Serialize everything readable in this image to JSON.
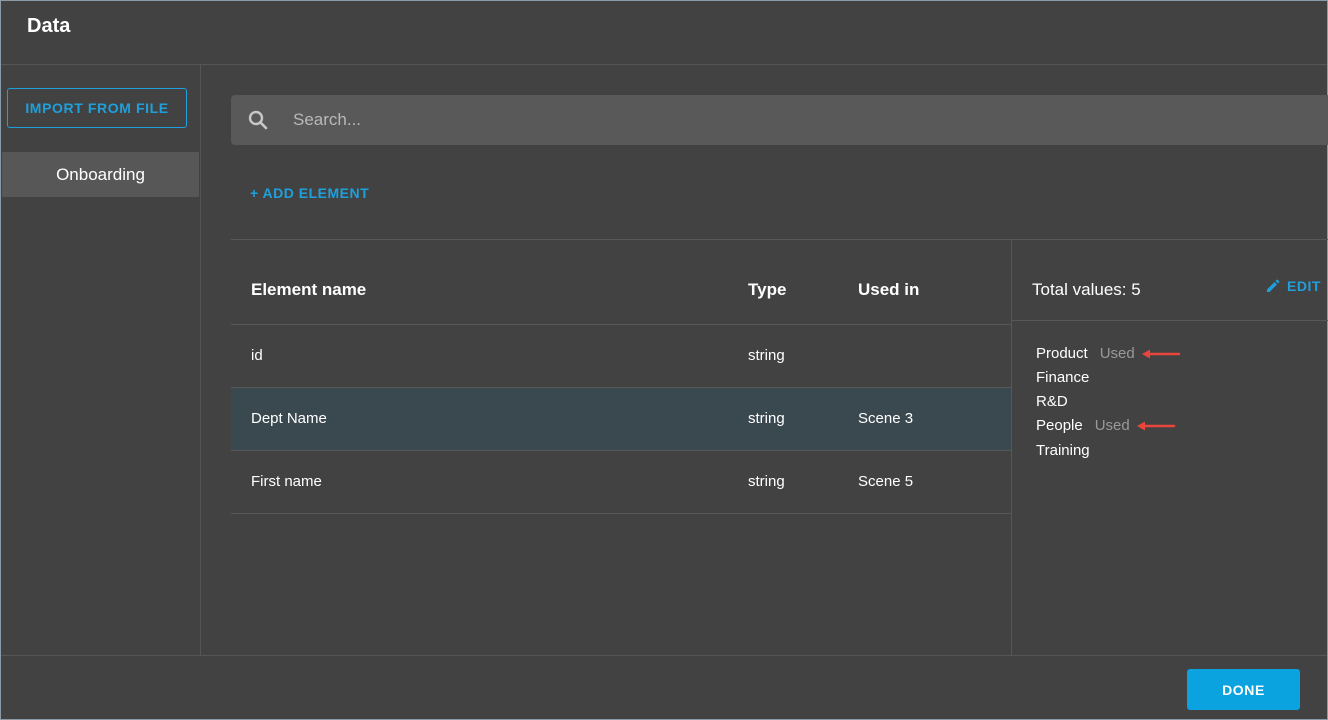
{
  "dialog": {
    "title": "Data"
  },
  "sidebar": {
    "import_label": "IMPORT FROM FILE",
    "items": [
      {
        "label": "Onboarding",
        "selected": true
      }
    ]
  },
  "search": {
    "placeholder": "Search...",
    "icon": "search-icon"
  },
  "toolbar": {
    "add_element_label": "+ ADD ELEMENT"
  },
  "table": {
    "headers": {
      "name": "Element name",
      "type": "Type",
      "used_in": "Used in"
    },
    "rows": [
      {
        "name": "id",
        "type": "string",
        "used_in": ""
      },
      {
        "name": "Dept Name",
        "type": "string",
        "used_in": "Scene 3",
        "selected": true
      },
      {
        "name": "First name",
        "type": "string",
        "used_in": "Scene 5"
      }
    ]
  },
  "values_panel": {
    "total_label": "Total values: 5",
    "edit_label": "EDIT",
    "edit_icon": "pencil-icon",
    "values": [
      {
        "label": "Product",
        "status": "Used"
      },
      {
        "label": "Finance",
        "status": ""
      },
      {
        "label": "R&D",
        "status": ""
      },
      {
        "label": "People",
        "status": "Used"
      },
      {
        "label": "Training",
        "status": ""
      }
    ],
    "annotation_color": "#e8453c"
  },
  "footer": {
    "done_label": "DONE"
  },
  "colors": {
    "accent": "#1ea0dc",
    "background": "#424242",
    "selected_row": "#3a4950"
  }
}
